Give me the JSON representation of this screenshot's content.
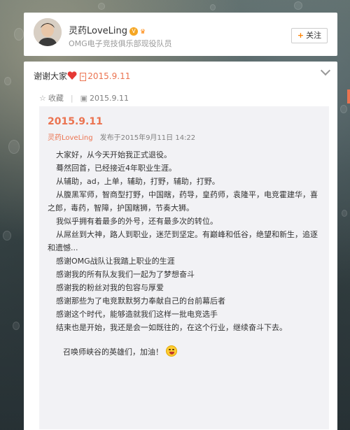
{
  "profile": {
    "name": "灵药LoveLing",
    "description": "OMG电子竞技俱乐部现役队员",
    "follow_label": "关注"
  },
  "post": {
    "text": "谢谢大家",
    "date_link": "2015.9.11",
    "actions": {
      "favorite_label": "收藏",
      "date_label": "2015.9.11"
    }
  },
  "article": {
    "date": "2015.9.11",
    "author": "灵药LoveLing",
    "published": "发布于2015年9月11日 14:22",
    "paragraphs": [
      "大家好，从今天开始我正式退役。",
      "蓦然回首，已经接近4年职业生涯。",
      "从辅助，ad，上单，辅助，打野，辅助，打野。",
      "从腹黑军师，智商型打野，中国瞎，药导，皇药师，袁隆平，电竞霍建华，喜之郎，毒药，智障，护国瞎狮，节奏大狮。",
      "我似乎拥有着最多的外号，还有最多次的转位。",
      "从屌丝到大神，路人到职业，迷茫到坚定。有巅峰和低谷，绝望和新生，追逐和遗憾...",
      "感谢OMG战队让我踏上职业的生涯",
      "感谢我的所有队友我们一起为了梦想奋斗",
      "感谢我的粉丝对我的包容与厚爱",
      "感谢那些为了电竞默默努力奉献自己的台前幕后者",
      "感谢这个时代，能够造就我们这样一批电竞选手",
      "结束也是开始，我还是会一如既往的，在这个行业，继续奋斗下去。"
    ],
    "closing": "召唤师峡谷的英雄们，加油！"
  }
}
